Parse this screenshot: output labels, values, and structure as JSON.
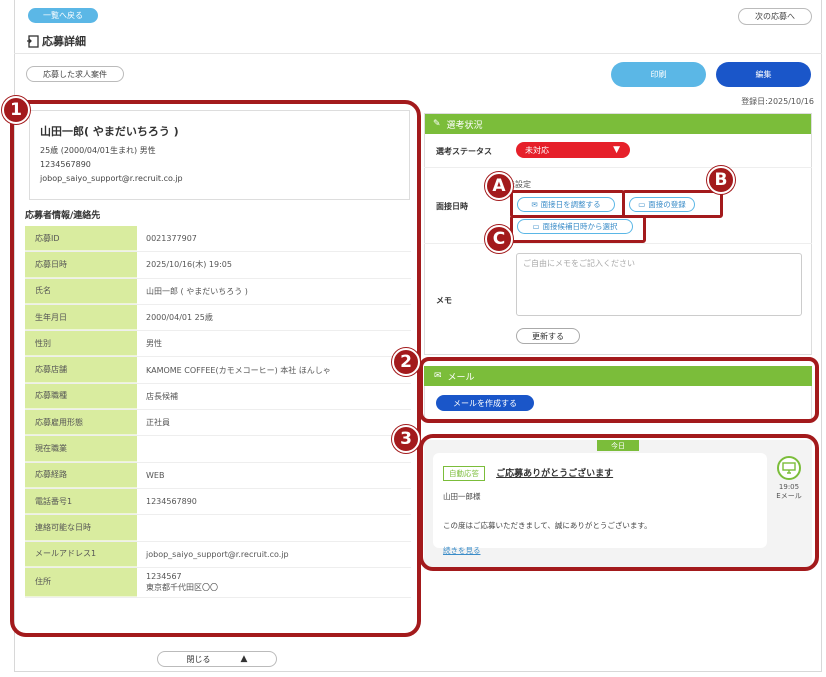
{
  "nav": {
    "back_label": "一覧へ戻る",
    "next_label": "次の応募へ"
  },
  "page": {
    "title": "応募詳細",
    "job_link_label": "応募した求人案件",
    "print_label": "印刷",
    "edit_label": "編集",
    "registered": "登録日:2025/10/16"
  },
  "profile": {
    "name": "山田一郎( やまだいちろう )",
    "age_gender": "25歳 (2000/04/01生まれ)  男性",
    "phone": "1234567890",
    "email": "jobop_saiyo_support@r.recruit.co.jp"
  },
  "applicant_section_title": "応募者情報/連絡先",
  "info": [
    {
      "label": "応募ID",
      "value": "0021377907"
    },
    {
      "label": "応募日時",
      "value": "2025/10/16(木) 19:05"
    },
    {
      "label": "氏名",
      "value": "山田一郎 ( やまだいちろう )"
    },
    {
      "label": "生年月日",
      "value": "2000/04/01 25歳"
    },
    {
      "label": "性別",
      "value": "男性"
    },
    {
      "label": "応募店舗",
      "value": "KAMOME COFFEE(カモメコーヒー) 本社 ほんしゃ"
    },
    {
      "label": "応募職種",
      "value": "店長候補"
    },
    {
      "label": "応募雇用形態",
      "value": "正社員"
    },
    {
      "label": "現在職業",
      "value": ""
    },
    {
      "label": "応募経路",
      "value": "WEB"
    },
    {
      "label": "電話番号1",
      "value": "1234567890"
    },
    {
      "label": "連絡可能な日時",
      "value": ""
    },
    {
      "label": "メールアドレス1",
      "value": "jobop_saiyo_support@r.recruit.co.jp"
    }
  ],
  "address": {
    "label": "住所",
    "zip": "1234567",
    "line": "東京都千代田区〇〇"
  },
  "close_label": "閉じる",
  "selection": {
    "header": "選考状況",
    "status_label": "選考ステータス",
    "status_value": "未対応",
    "interview_label": "面接日時",
    "interview_state": "未設定",
    "adjust_label": "面接日を調整する",
    "register_label": "面接の登録",
    "choose_label": "面接候補日時から選択",
    "memo_label": "メモ",
    "memo_placeholder": "ご自由にメモをご記入ください",
    "update_label": "更新する"
  },
  "mail": {
    "header": "メール",
    "compose_label": "メールを作成する"
  },
  "messages": {
    "today": "今日",
    "tag": "自動応答",
    "subject": "ご応募ありがとうございます",
    "to": "山田一郎様",
    "body": "この度はご応募いただきまして、誠にありがとうございます。",
    "more": "続きを見る",
    "time": "19:05",
    "channel": "Eメール"
  },
  "annotations": {
    "n1": "1",
    "n2": "2",
    "n3": "3",
    "a": "A",
    "b": "B",
    "c": "C"
  },
  "colors": {
    "accent_green": "#7bbd3a",
    "accent_blue": "#1a56c9",
    "status_red": "#e6202a",
    "annotation_red": "#a31a1c"
  }
}
